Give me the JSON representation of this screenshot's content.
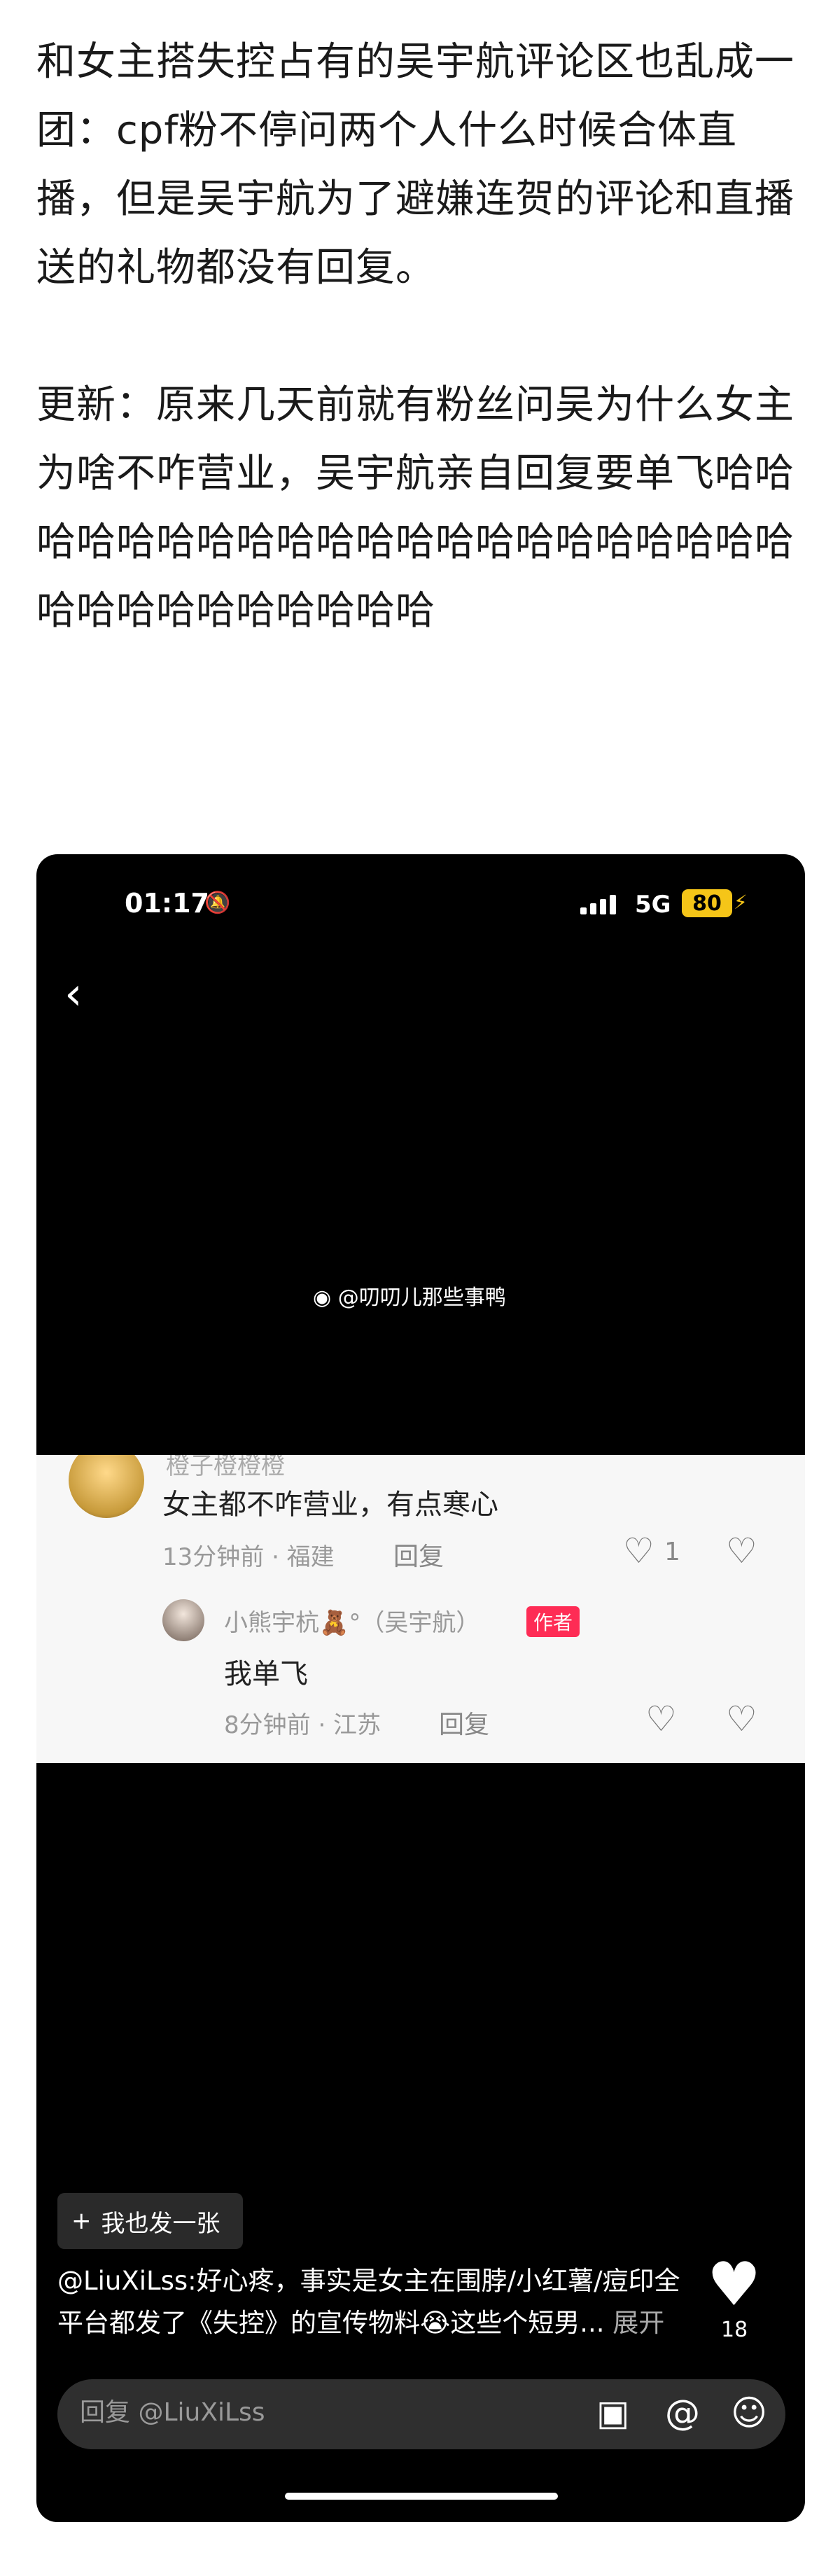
{
  "article": {
    "paragraph1": "和女主搭失控占有的吴宇航评论区也乱成一团：cpf粉不停问两个人什么时候合体直播，但是吴宇航为了避嫌连贺的评论和直播送的礼物都没有回复。",
    "paragraph2": "更新：原来几天前就有粉丝问吴为什么女主为啥不咋营业，吴宇航亲自回复要单飞哈哈哈哈哈哈哈哈哈哈哈哈哈哈哈哈哈哈哈哈哈哈哈哈哈哈哈哈哈哈哈"
  },
  "phone": {
    "status": {
      "time": "01:17",
      "network": "5G",
      "battery": "80"
    },
    "watermark": "@叨叨儿那些事鸭",
    "comment": {
      "cut_username": "橙子橙橙橙",
      "text": "女主都不咋营业，有点寒心",
      "meta": "13分钟前 · 福建",
      "reply_label": "回复",
      "likes": "1"
    },
    "reply": {
      "username": "小熊宇杭🧸°（吴宇航）",
      "badge": "作者",
      "text": "我单飞",
      "meta": "8分钟前 · 江苏",
      "reply_label": "回复"
    },
    "post_button": "我也发一张",
    "caption": {
      "text": "@LiuXiLss:好心疼，事实是女主在围脖/小红薯/痘印全平台都发了《失控》的宣传物料😭这些个短男...",
      "expand": "展开"
    },
    "like_total": "18",
    "reply_bar": {
      "placeholder": "回复 @LiuXiLss"
    }
  }
}
